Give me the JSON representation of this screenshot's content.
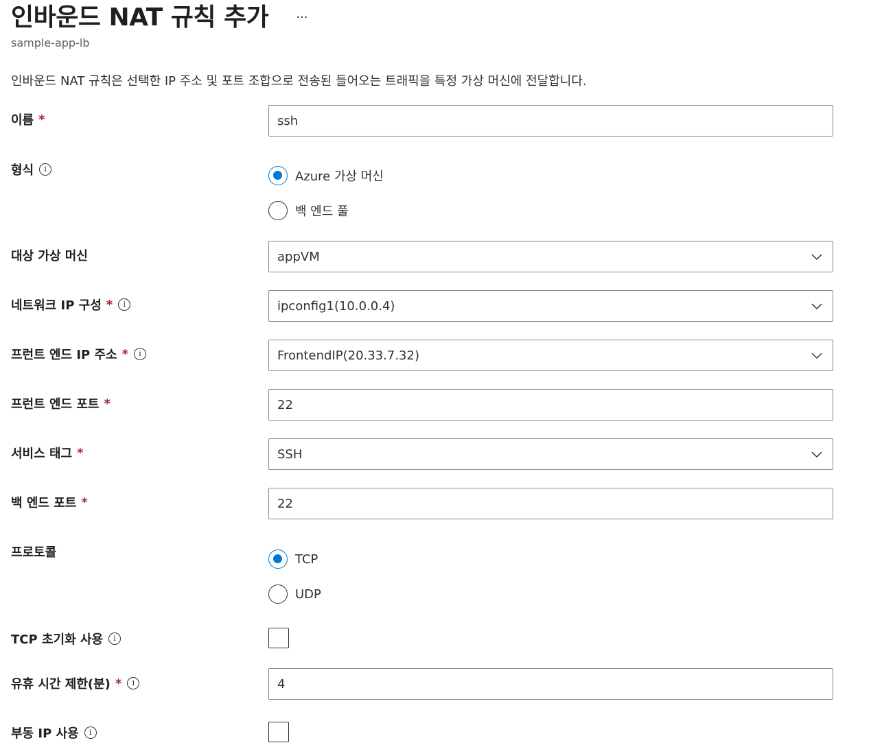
{
  "header": {
    "title": "인바운드 NAT 규칙 추가",
    "more_label": "···",
    "subtitle": "sample-app-lb"
  },
  "description": "인바운드 NAT 규칙은 선택한 IP 주소 및 포트 조합으로 전송된 들어오는 트래픽을 특정 가상 머신에 전달합니다.",
  "required_marker": "*",
  "info_glyph": "i",
  "form": {
    "name": {
      "label": "이름",
      "value": "ssh"
    },
    "type": {
      "label": "형식",
      "options": [
        {
          "label": "Azure 가상 머신",
          "checked": true
        },
        {
          "label": "백 엔드 풀",
          "checked": false
        }
      ]
    },
    "target_vm": {
      "label": "대상 가상 머신",
      "value": "appVM"
    },
    "network_ip_config": {
      "label": "네트워크 IP 구성",
      "value": "ipconfig1(10.0.0.4)"
    },
    "frontend_ip": {
      "label": "프런트 엔드 IP 주소",
      "value": "FrontendIP(20.33.7.32)"
    },
    "frontend_port": {
      "label": "프런트 엔드 포트",
      "value": "22"
    },
    "service_tag": {
      "label": "서비스 태그",
      "value": "SSH"
    },
    "backend_port": {
      "label": "백 엔드 포트",
      "value": "22"
    },
    "protocol": {
      "label": "프로토콜",
      "options": [
        {
          "label": "TCP",
          "checked": true
        },
        {
          "label": "UDP",
          "checked": false
        }
      ]
    },
    "tcp_reset": {
      "label": "TCP 초기화 사용",
      "checked": false
    },
    "idle_timeout": {
      "label": "유휴 시간 제한(분)",
      "value": "4"
    },
    "floating_ip": {
      "label": "부동 IP 사용",
      "checked": false
    }
  },
  "colors": {
    "accent": "#0078d4",
    "required": "#a4262c",
    "border": "#8a8886",
    "text": "#323130"
  },
  "icons": {
    "dropdown": "chevron-down-icon",
    "info": "info-icon"
  }
}
